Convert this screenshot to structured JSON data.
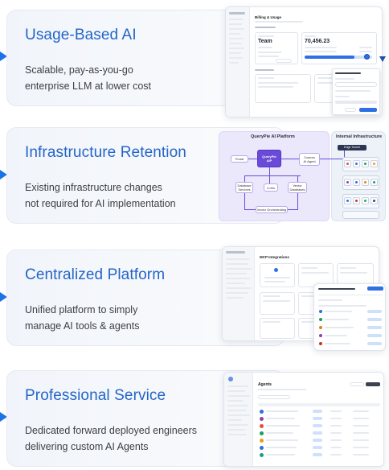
{
  "cards": [
    {
      "title": "Usage-Based AI",
      "desc_line1": "Scalable, pay-as-you-go",
      "desc_line2": "enterprise LLM at lower cost"
    },
    {
      "title": "Infrastructure Retention",
      "desc_line1": "Existing infrastructure changes",
      "desc_line2": "not required for AI implementation"
    },
    {
      "title": "Centralized Platform",
      "desc_line1": "Unified platform to simply",
      "desc_line2": "manage AI tools & agents"
    },
    {
      "title": "Professional Service",
      "desc_line1": "Dedicated forward deployed engineers",
      "desc_line2": "delivering custom AI Agents"
    }
  ],
  "shot1": {
    "heading": "Billing & Usage",
    "plan_name": "Team",
    "amount": "70,456.23"
  },
  "diagram": {
    "left_title": "QueryPie AI Platform",
    "right_title": "Internal Infrastructure",
    "portal": "Portal",
    "core_line1": "QueryPie",
    "core_line2": "AIP",
    "custom_line1": "Custom",
    "custom_line2": "AI Agent",
    "edge": "Edge Tunnel",
    "db_line1": "Database",
    "db_line2": "Services",
    "llms": "LLMs",
    "vector_line1": "Vector",
    "vector_line2": "Databases",
    "orchestration": "Vector Orchestrating"
  },
  "shot3": {
    "heading": "MCP Integrations"
  },
  "shot4": {
    "heading": "Agents"
  },
  "colors": {
    "accent": "#2465c8",
    "arrow": "#1a73e8",
    "diagram_purple": "#6a4bd8"
  }
}
